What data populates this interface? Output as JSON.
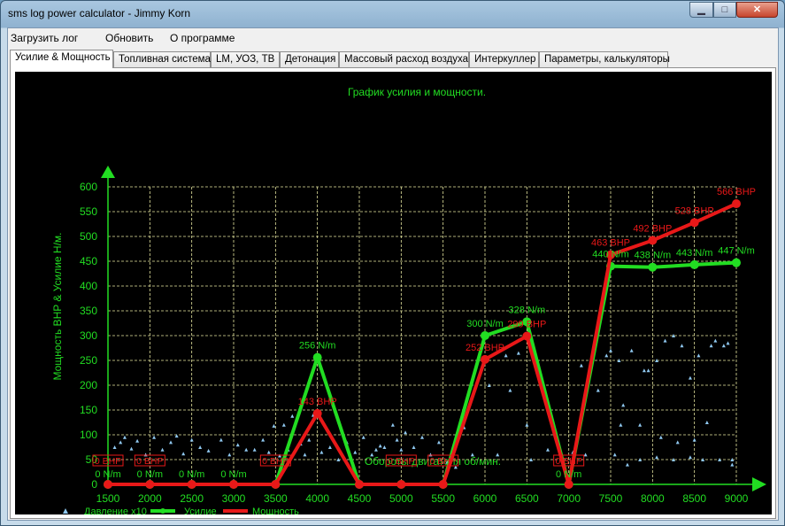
{
  "window": {
    "title": "sms log power calculator - Jimmy Korn",
    "min_glyph": "▁",
    "max_glyph": "□",
    "close_glyph": "✕"
  },
  "menu": [
    "Загрузить лог",
    "Обновить",
    "О программе"
  ],
  "tabs": [
    {
      "label": "Усилие & Мощность",
      "active": true
    },
    {
      "label": "Топливная система",
      "active": false
    },
    {
      "label": "LM, УОЗ, ТВ",
      "active": false
    },
    {
      "label": "Детонация",
      "active": false
    },
    {
      "label": "Массовый расход воздуха",
      "active": false
    },
    {
      "label": "Интеркуллер",
      "active": false
    },
    {
      "label": "Параметры, калькуляторы",
      "active": false
    }
  ],
  "chart_data": {
    "type": "line",
    "title": "График усилия и мощности.",
    "xlabel": "Обороты двигателя об/мин.",
    "ylabel": "Мощность BHP & Усилие Н/м.",
    "xlim": [
      1500,
      9000
    ],
    "ylim": [
      0,
      600
    ],
    "xticks": [
      1500,
      2000,
      2500,
      3000,
      3500,
      4000,
      4500,
      5000,
      5500,
      6000,
      6500,
      7000,
      7500,
      8000,
      8500,
      9000
    ],
    "yticks": [
      0,
      50,
      100,
      150,
      200,
      250,
      300,
      350,
      400,
      450,
      500,
      550,
      600
    ],
    "grid": true,
    "legend_position": "bottom-left",
    "colors": {
      "torque": "#22dd22",
      "power": "#e81818",
      "pressure": "#8fc8f0",
      "text": "#22dd22",
      "grid": "#e8e8a0"
    },
    "series": [
      {
        "name": "Усилие",
        "unit": "N/m",
        "x": [
          1500,
          2000,
          2500,
          3000,
          3500,
          4000,
          4500,
          5000,
          5500,
          6000,
          6500,
          7000,
          7500,
          8000,
          8500,
          9000
        ],
        "values": [
          0,
          0,
          0,
          0,
          0,
          256,
          0,
          0,
          0,
          300,
          328,
          0,
          440,
          438,
          443,
          447
        ],
        "labels": [
          "0 N/m",
          "0 N/m",
          "0 N/m",
          "0 N/m",
          "",
          "256 N/m",
          "",
          "",
          "",
          "300 N/m",
          "328 N/m",
          "0 N/m",
          "440 N/m",
          "438 N/m",
          "443 N/m",
          "447 N/m"
        ]
      },
      {
        "name": "Мощность",
        "unit": "BHP",
        "x": [
          1500,
          2000,
          2500,
          3000,
          3500,
          4000,
          4500,
          5000,
          5500,
          6000,
          6500,
          7000,
          7500,
          8000,
          8500,
          9000
        ],
        "values": [
          0,
          0,
          0,
          0,
          0,
          143,
          0,
          0,
          0,
          252,
          299,
          0,
          463,
          492,
          528,
          566
        ],
        "labels": [
          "0 BHP",
          "0 BHP",
          "",
          "",
          "0 BHP",
          "143 BHP",
          "",
          "0 BHP",
          "0 BHP",
          "252 BHP",
          "299 BHP",
          "0 BHP",
          "463 BHP",
          "492 BHP",
          "528 BHP",
          "566 BHP"
        ]
      },
      {
        "name": "Давление x10",
        "unit": "",
        "x": [
          1580,
          1650,
          1700,
          1780,
          1850,
          1950,
          2050,
          2150,
          2250,
          2320,
          2400,
          2500,
          2600,
          2700,
          2850,
          2950,
          3050,
          3150,
          3250,
          3350,
          3420,
          3480,
          3550,
          3600,
          3650,
          3700,
          3800,
          3850,
          3900,
          3950,
          4050,
          4150,
          4250,
          4350,
          4450,
          4550,
          4650,
          4700,
          4750,
          4800,
          4900,
          4950,
          5000,
          5050,
          5150,
          5250,
          5350,
          5450,
          5550,
          5650,
          5750,
          5850,
          6050,
          6150,
          6250,
          6300,
          6400,
          6500,
          6550,
          6650,
          6750,
          7050,
          7150,
          7200,
          7350,
          7450,
          7550,
          7600,
          7650,
          7750,
          7850,
          7950,
          8050,
          8150,
          8250,
          8350,
          8450,
          8550,
          8650,
          8750,
          8850,
          8950,
          7700,
          7850,
          8050,
          8250,
          8450,
          8600,
          8800,
          8950,
          7500,
          7620,
          7900,
          8100,
          8300,
          8500,
          8700,
          8900
        ],
        "values": [
          75,
          85,
          95,
          72,
          88,
          60,
          95,
          70,
          85,
          98,
          62,
          90,
          75,
          68,
          90,
          60,
          80,
          70,
          70,
          90,
          65,
          118,
          58,
          120,
          70,
          138,
          82,
          60,
          90,
          140,
          65,
          75,
          50,
          85,
          65,
          95,
          60,
          70,
          78,
          75,
          120,
          90,
          70,
          105,
          75,
          95,
          60,
          85,
          45,
          35,
          115,
          60,
          200,
          60,
          260,
          190,
          265,
          120,
          50,
          220,
          70,
          65,
          240,
          60,
          190,
          260,
          60,
          250,
          160,
          270,
          120,
          230,
          250,
          290,
          300,
          280,
          215,
          260,
          125,
          290,
          280,
          40,
          40,
          50,
          55,
          50,
          55,
          50,
          50,
          50,
          270,
          120,
          230,
          95,
          85,
          90,
          280,
          285
        ]
      }
    ]
  },
  "legend": [
    {
      "name": "Давление x10"
    },
    {
      "name": "Усилие"
    },
    {
      "name": "Мощность"
    }
  ]
}
